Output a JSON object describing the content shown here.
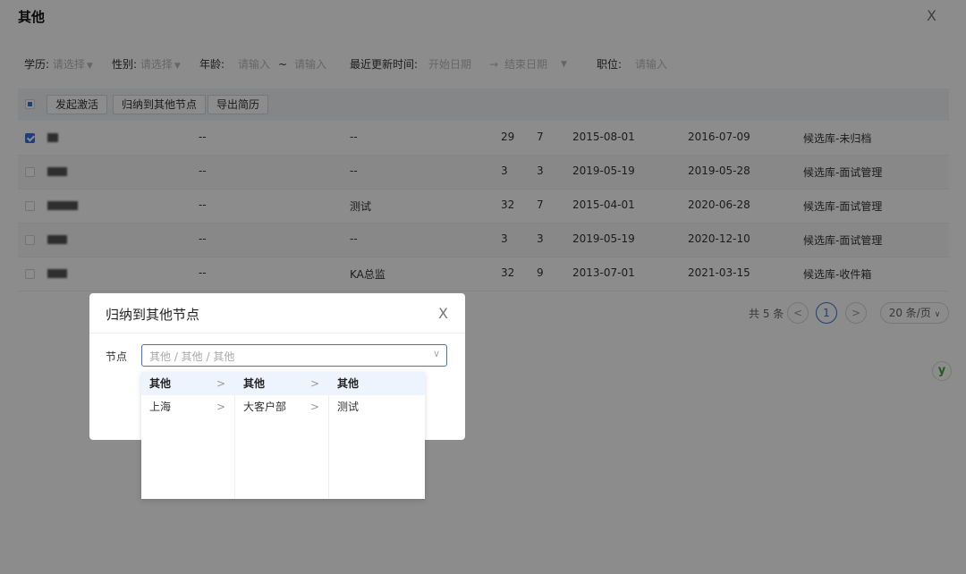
{
  "header": {
    "title": "其他",
    "close": "X"
  },
  "filters": {
    "education_label": "学历:",
    "education_placeholder": "请选择",
    "gender_label": "性别:",
    "gender_placeholder": "请选择",
    "age_label": "年龄:",
    "age_from_placeholder": "请输入",
    "age_sep": "~",
    "age_to_placeholder": "请输入",
    "updated_label": "最近更新时间:",
    "start_placeholder": "开始日期",
    "range_arrow": "→",
    "end_placeholder": "结束日期",
    "position_label": "职位:",
    "position_placeholder": "请输入"
  },
  "toolbar": {
    "activate": "发起激活",
    "move_node": "归纳到其他节点",
    "export": "导出简历"
  },
  "rows": [
    {
      "c1": "--",
      "c2": "--",
      "n1": "29",
      "n2": "7",
      "d1": "2015-08-01",
      "d2": "2016-07-09",
      "status": "候选库-未归档",
      "checked": true
    },
    {
      "c1": "--",
      "c2": "--",
      "n1": "3",
      "n2": "3",
      "d1": "2019-05-19",
      "d2": "2019-05-28",
      "status": "候选库-面试管理",
      "checked": false
    },
    {
      "c1": "--",
      "c2": "测试",
      "n1": "32",
      "n2": "7",
      "d1": "2015-04-01",
      "d2": "2020-06-28",
      "status": "候选库-面试管理",
      "checked": false
    },
    {
      "c1": "--",
      "c2": "--",
      "n1": "3",
      "n2": "3",
      "d1": "2019-05-19",
      "d2": "2020-12-10",
      "status": "候选库-面试管理",
      "checked": false
    },
    {
      "c1": "--",
      "c2": "KA总监",
      "n1": "32",
      "n2": "9",
      "d1": "2013-07-01",
      "d2": "2021-03-15",
      "status": "候选库-收件箱",
      "checked": false
    }
  ],
  "pagination": {
    "total": "共 5 条",
    "prev": "<",
    "page": "1",
    "next": ">",
    "page_size": "20 条/页"
  },
  "side_icon_text": "y",
  "dialog": {
    "title": "归纳到其他节点",
    "close": "X",
    "node_label": "节点",
    "cascader_placeholder": "其他 / 其他 / 其他",
    "columns": [
      [
        {
          "label": "其他",
          "selected": true,
          "chevron": ">"
        },
        {
          "label": "上海",
          "selected": false,
          "chevron": ">"
        }
      ],
      [
        {
          "label": "其他",
          "selected": true,
          "chevron": ">"
        },
        {
          "label": "大客户部",
          "selected": false,
          "chevron": ">"
        }
      ],
      [
        {
          "label": "其他",
          "selected": true,
          "chevron": ""
        },
        {
          "label": "测试",
          "selected": false,
          "chevron": ""
        }
      ]
    ]
  }
}
